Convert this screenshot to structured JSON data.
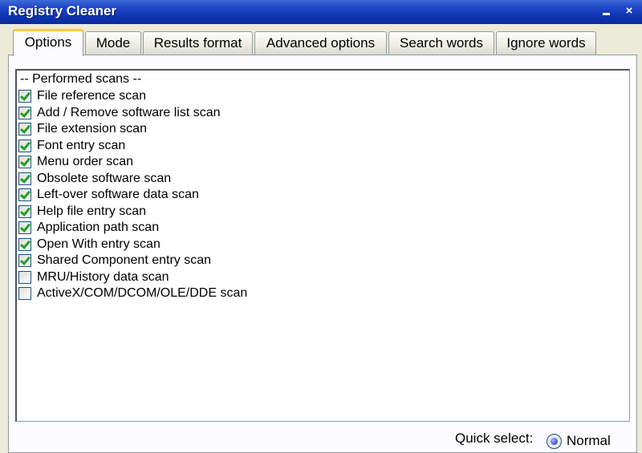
{
  "window": {
    "title": "Registry Cleaner",
    "minimize_glyph": "",
    "close_glyph": "×"
  },
  "tabs": [
    {
      "label": "Options",
      "active": true
    },
    {
      "label": "Mode",
      "active": false
    },
    {
      "label": "Results format",
      "active": false
    },
    {
      "label": "Advanced options",
      "active": false
    },
    {
      "label": "Search words",
      "active": false
    },
    {
      "label": "Ignore words",
      "active": false
    }
  ],
  "scan_list": {
    "header": "-- Performed scans --",
    "items": [
      {
        "label": "File reference scan",
        "checked": true
      },
      {
        "label": "Add / Remove software list scan",
        "checked": true
      },
      {
        "label": "File extension scan",
        "checked": true
      },
      {
        "label": "Font entry scan",
        "checked": true
      },
      {
        "label": "Menu order scan",
        "checked": true
      },
      {
        "label": "Obsolete software scan",
        "checked": true
      },
      {
        "label": "Left-over software data scan",
        "checked": true
      },
      {
        "label": "Help file entry scan",
        "checked": true
      },
      {
        "label": "Application path scan",
        "checked": true
      },
      {
        "label": "Open With entry scan",
        "checked": true
      },
      {
        "label": "Shared Component entry scan",
        "checked": true
      },
      {
        "label": "MRU/History data scan",
        "checked": false
      },
      {
        "label": "ActiveX/COM/DCOM/OLE/DDE scan",
        "checked": false
      }
    ]
  },
  "quick_select": {
    "label": "Quick select:",
    "option": "Normal",
    "selected": true
  },
  "colors": {
    "titlebar": "#0f33b0",
    "active_tab_accent": "#ffc83c",
    "check_mark": "#21a121"
  }
}
